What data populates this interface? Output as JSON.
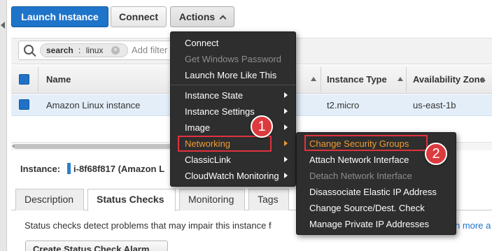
{
  "toolbar": {
    "launch_label": "Launch Instance",
    "connect_label": "Connect",
    "actions_label": "Actions"
  },
  "search": {
    "token_key": "search",
    "token_separator": ":",
    "token_value": "linux",
    "token_remove": "×",
    "placeholder": "Add filter"
  },
  "table": {
    "columns": [
      "Name",
      "Instance Type",
      "Availability Zone"
    ],
    "rows": [
      {
        "name": "Amazon Linux instance",
        "instance_type": "t2.micro",
        "availability_zone": "us-east-1b"
      }
    ]
  },
  "instance": {
    "label": "Instance:",
    "value": "i-8f68f817 (Amazon L"
  },
  "tabs": [
    "Description",
    "Status Checks",
    "Monitoring",
    "Tags"
  ],
  "status_checks": {
    "description": "Status checks detect problems that may impair this instance f",
    "learn_more": "n more a",
    "create_alarm_label": "Create Status Check Alarm"
  },
  "actions_menu": {
    "items": [
      {
        "label": "Connect",
        "enabled": true
      },
      {
        "label": "Get Windows Password",
        "enabled": false
      },
      {
        "label": "Launch More Like This",
        "enabled": true
      },
      {
        "label": "Instance State",
        "enabled": true
      },
      {
        "label": "Instance Settings",
        "enabled": true
      },
      {
        "label": "Image",
        "enabled": true
      },
      {
        "label": "Networking",
        "enabled": true
      },
      {
        "label": "ClassicLink",
        "enabled": true
      },
      {
        "label": "CloudWatch Monitoring",
        "enabled": true
      }
    ]
  },
  "networking_submenu": {
    "items": [
      {
        "label": "Change Security Groups",
        "enabled": true
      },
      {
        "label": "Attach Network Interface",
        "enabled": true
      },
      {
        "label": "Detach Network Interface",
        "enabled": false
      },
      {
        "label": "Disassociate Elastic IP Address",
        "enabled": true
      },
      {
        "label": "Change Source/Dest. Check",
        "enabled": true
      },
      {
        "label": "Manage Private IP Addresses",
        "enabled": true
      }
    ]
  },
  "steps": [
    "1",
    "2"
  ],
  "colors": {
    "primary_blue": "#1e74c9",
    "menu_background": "#2e2e2e",
    "highlight_orange": "#f09b33",
    "annotation_red": "#e0323e"
  },
  "icons": {
    "search": "search-icon",
    "remove_token": "close-icon",
    "actions_caret": "chevron-up-icon",
    "submenu_arrow": "chevron-right-icon"
  }
}
